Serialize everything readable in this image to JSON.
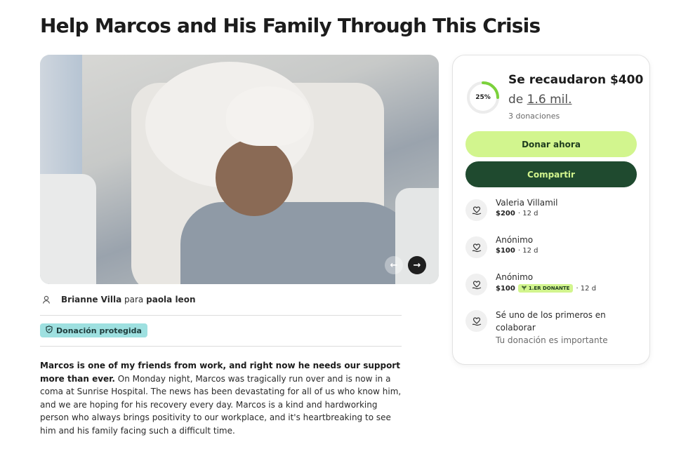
{
  "page_title": "Help Marcos and His Family Through This Crisis",
  "gallery": {
    "prev_icon": "arrow-left-icon",
    "next_icon": "arrow-right-icon"
  },
  "organizer": {
    "name": "Brianne Villa",
    "connector": "para",
    "beneficiary": "paola leon"
  },
  "protected_badge": "Donación protegida",
  "story": {
    "lead": "Marcos is one of my friends from work, and right now he needs our support more than ever.",
    "body": " On Monday night, Marcos was tragically run over and is now in a coma at Sunrise Hospital. The news has been devastating for all of us who know him, and we are hoping for his recovery every day. Marcos is a kind and hardworking person who always brings positivity to our workplace, and it's heartbreaking to see him and his family facing such a difficult time."
  },
  "progress": {
    "percent_label": "25%",
    "percent": 25,
    "raised_label": "Se recaudaron $400",
    "goal_prefix": "de",
    "goal_amount": "1.6 mil.",
    "donation_count": "3 donaciones"
  },
  "actions": {
    "donate_label": "Donar ahora",
    "share_label": "Compartir"
  },
  "donations": [
    {
      "name": "Valeria Villamil",
      "amount": "$200",
      "time": "· 12 d",
      "badge": ""
    },
    {
      "name": "Anónimo",
      "amount": "$100",
      "time": "· 12 d",
      "badge": ""
    },
    {
      "name": "Anónimo",
      "amount": "$100",
      "time": "· 12 d",
      "badge": "1.ER DONANTE"
    }
  ],
  "cta": {
    "title": "Sé uno de los primeros en colaborar",
    "subtitle": "Tu donación es importante"
  },
  "colors": {
    "accent_light": "#d2f58e",
    "accent_dark": "#1f4a2f",
    "badge_teal": "#9ee0e0",
    "ring_progress": "#7bd13b"
  }
}
